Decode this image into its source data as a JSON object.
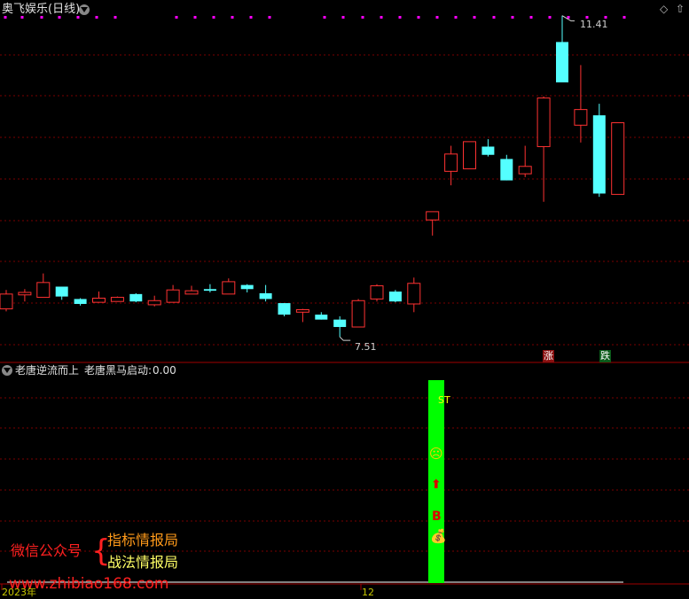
{
  "header": {
    "title": "奥飞娱乐(日线)"
  },
  "indicator": {
    "name": "老唐逆流而上",
    "series_label": "老唐黑马启动:",
    "series_value": "0.00"
  },
  "markers": {
    "high_label": "11.41",
    "low_label": "7.51",
    "rise_label": "涨",
    "fall_label": "跌",
    "st_label": "ST",
    "b_label": "B"
  },
  "x_axis": {
    "year_label": "2023年",
    "month_label": "12"
  },
  "watermark": {
    "account_label": "微信公众号",
    "line1": "指标情报局",
    "line2": "战法情报局",
    "url": "www.zhibiao168.com"
  },
  "colors": {
    "up": "#ff3232",
    "down": "#54ffff",
    "grid": "#7a0000",
    "signal_bar": "#00ff00",
    "dots": "#ff00ff"
  },
  "chart_data": {
    "type": "candlestick",
    "ylim": [
      7.2,
      11.6
    ],
    "candles": [
      {
        "o": 7.85,
        "h": 8.08,
        "l": 7.82,
        "c": 8.03
      },
      {
        "o": 8.02,
        "h": 8.09,
        "l": 7.94,
        "c": 8.05
      },
      {
        "o": 7.99,
        "h": 8.28,
        "l": 7.99,
        "c": 8.17
      },
      {
        "o": 8.12,
        "h": 8.12,
        "l": 7.96,
        "c": 8.0
      },
      {
        "o": 7.97,
        "h": 7.98,
        "l": 7.89,
        "c": 7.91
      },
      {
        "o": 7.93,
        "h": 8.06,
        "l": 7.93,
        "c": 7.98
      },
      {
        "o": 7.94,
        "h": 8.0,
        "l": 7.94,
        "c": 7.99
      },
      {
        "o": 8.03,
        "h": 8.04,
        "l": 7.93,
        "c": 7.94
      },
      {
        "o": 7.9,
        "h": 8.01,
        "l": 7.88,
        "c": 7.95
      },
      {
        "o": 7.93,
        "h": 8.14,
        "l": 7.93,
        "c": 8.08
      },
      {
        "o": 8.03,
        "h": 8.13,
        "l": 8.03,
        "c": 8.07
      },
      {
        "o": 8.09,
        "h": 8.15,
        "l": 8.05,
        "c": 8.07
      },
      {
        "o": 8.03,
        "h": 8.22,
        "l": 8.03,
        "c": 8.18
      },
      {
        "o": 8.14,
        "h": 8.15,
        "l": 8.05,
        "c": 8.09
      },
      {
        "o": 8.04,
        "h": 8.14,
        "l": 7.94,
        "c": 7.97
      },
      {
        "o": 7.92,
        "h": 7.92,
        "l": 7.76,
        "c": 7.78
      },
      {
        "o": 7.81,
        "h": 7.85,
        "l": 7.69,
        "c": 7.84
      },
      {
        "o": 7.78,
        "h": 7.81,
        "l": 7.72,
        "c": 7.72
      },
      {
        "o": 7.72,
        "h": 7.76,
        "l": 7.51,
        "c": 7.63
      },
      {
        "o": 7.63,
        "h": 7.97,
        "l": 7.63,
        "c": 7.95
      },
      {
        "o": 7.97,
        "h": 8.15,
        "l": 7.94,
        "c": 8.13
      },
      {
        "o": 8.06,
        "h": 8.08,
        "l": 7.93,
        "c": 7.94
      },
      {
        "o": 7.91,
        "h": 8.23,
        "l": 7.81,
        "c": 8.16
      },
      {
        "o": 8.93,
        "h": 9.01,
        "l": 8.74,
        "c": 9.03
      },
      {
        "o": 9.52,
        "h": 9.83,
        "l": 9.35,
        "c": 9.73
      },
      {
        "o": 9.55,
        "h": 9.85,
        "l": 9.55,
        "c": 9.88
      },
      {
        "o": 9.82,
        "h": 9.91,
        "l": 9.7,
        "c": 9.72
      },
      {
        "o": 9.67,
        "h": 9.72,
        "l": 9.41,
        "c": 9.41
      },
      {
        "o": 9.49,
        "h": 9.83,
        "l": 9.45,
        "c": 9.58
      },
      {
        "o": 9.82,
        "h": 10.43,
        "l": 9.15,
        "c": 10.41
      },
      {
        "o": 11.09,
        "h": 11.41,
        "l": 10.71,
        "c": 10.6
      },
      {
        "o": 10.08,
        "h": 10.81,
        "l": 9.87,
        "c": 10.27
      },
      {
        "o": 10.2,
        "h": 10.34,
        "l": 9.21,
        "c": 9.25
      },
      {
        "o": 9.24,
        "h": 10.11,
        "l": 9.24,
        "c": 10.11
      }
    ]
  }
}
